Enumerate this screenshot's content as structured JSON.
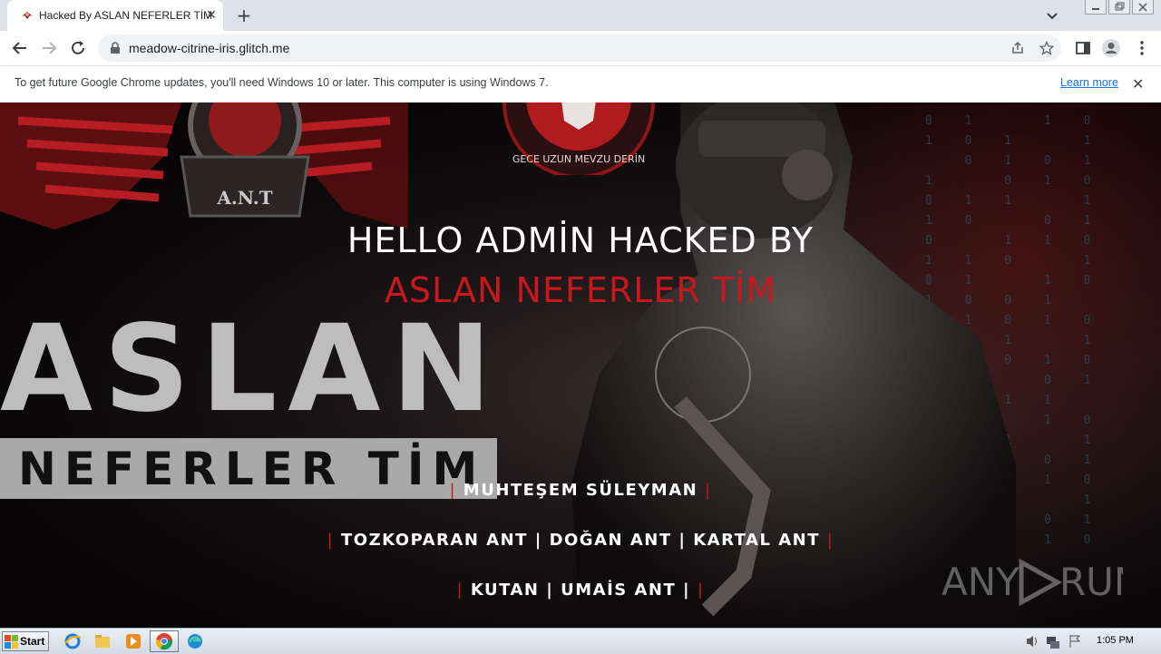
{
  "browser": {
    "tab_title": "Hacked By ASLAN NEFERLER TİM",
    "url": "meadow-citrine-iris.glitch.me",
    "new_tab_symbol": "+",
    "close_symbol": "✕"
  },
  "infobar": {
    "message": "To get future Google Chrome updates, you'll need Windows 10 or later. This computer is using Windows 7.",
    "link": "Learn more",
    "close_symbol": "✕"
  },
  "page": {
    "logo_text": "A.N.T",
    "badge_text": "GECE UZUN MEVZU DERİN",
    "headline_white": "HELLO ADMİN HACKED BY",
    "headline_red": "ASLAN NEFERLER TİM",
    "background_big_word": "ASLAN",
    "background_sub_word": "NEFERLER TİM",
    "team_line_1": "MUHTEŞEM SÜLEYMAN",
    "team_line_2": "TOZKOPARAN ANT | DOĞAN ANT | KARTAL ANT",
    "team_line_3": "KUTAN | UMAİS ANT |",
    "pipe": "|",
    "watermark": "ANY RUN"
  },
  "taskbar": {
    "start_label": "Start",
    "clock": "1:05 PM",
    "icons": [
      "ie-icon",
      "explorer-icon",
      "media-player-icon",
      "chrome-icon",
      "edge-icon"
    ]
  },
  "colors": {
    "accent_red": "#c8171d",
    "link_blue": "#1a73e8"
  }
}
